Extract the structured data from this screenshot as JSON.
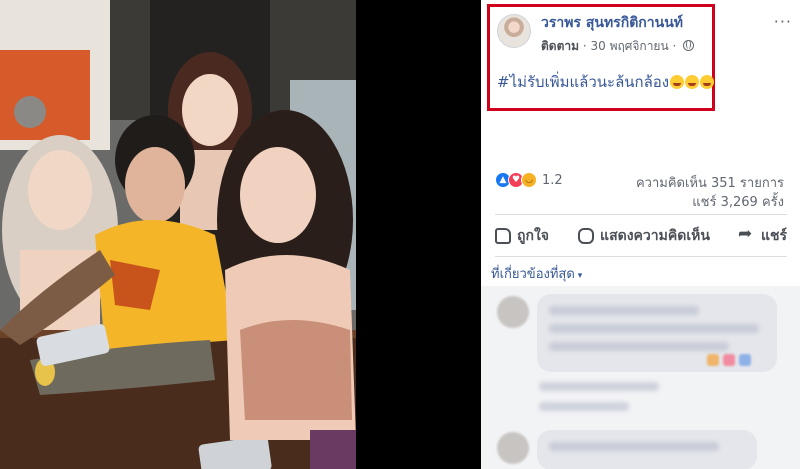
{
  "post": {
    "author": "วราพร สุนทรกิติกานนท์",
    "follow_label": "ติดตาม",
    "separator": "·",
    "date": "30 พฤศจิกายน",
    "separator2": "·",
    "more_label": "···",
    "text": "#ไม่รับเพิ่มแล้วนะล้นกล้อง"
  },
  "engagement": {
    "reaction_count": "1.2",
    "comments": "ความคิดเห็น 351 รายการ",
    "shares": "แชร์ 3,269 ครั้ง"
  },
  "actions": {
    "like": "ถูกใจ",
    "comment": "แสดงความคิดเห็น",
    "share": "แชร์"
  },
  "comments": {
    "sort_label": "ที่เกี่ยวข้องที่สุด",
    "caret": "▾"
  },
  "colors": {
    "link": "#385898",
    "highlight": "#d0021b",
    "like": "#1877f2",
    "love": "#f33e58",
    "haha": "#f7b125"
  }
}
